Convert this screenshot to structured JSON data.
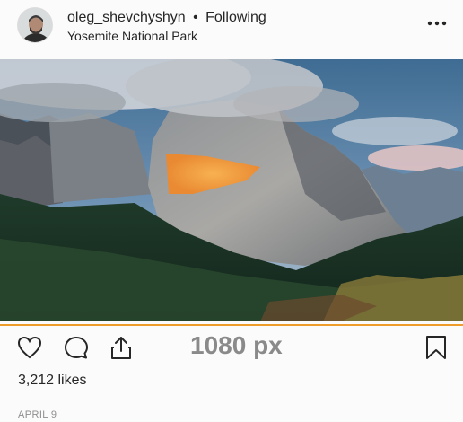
{
  "post": {
    "username": "oleg_shevchyshyn",
    "separator": "•",
    "follow_status": "Following",
    "location": "Yosemite National Park",
    "likes": "3,212 likes",
    "date": "APRIL 9",
    "overlay_label": "1080 px"
  },
  "icons": {
    "more": "more-options-icon",
    "like": "heart-icon",
    "comment": "comment-icon",
    "share": "share-icon",
    "save": "bookmark-icon"
  },
  "colors": {
    "divider": "#ee9c2a",
    "overlay_text": "#8a8a8a",
    "text": "#262626",
    "muted": "#8e8e8e"
  }
}
